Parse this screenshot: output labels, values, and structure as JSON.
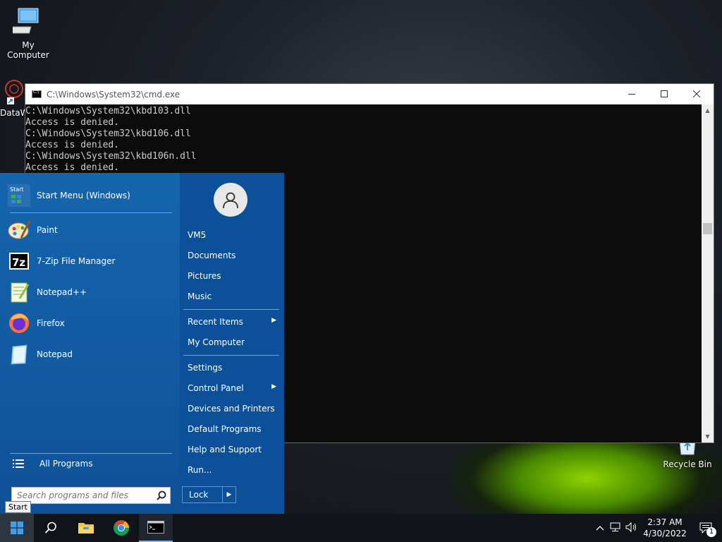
{
  "desktop": {
    "icons": [
      {
        "label": "My Computer"
      },
      {
        "label": "DataW"
      },
      {
        "label": "Recycle Bin"
      }
    ]
  },
  "cmd": {
    "title": "C:\\Windows\\System32\\cmd.exe",
    "lines": [
      "C:\\Windows\\System32\\kbd103.dll",
      "Access is denied.",
      "C:\\Windows\\System32\\kbd106.dll",
      "Access is denied.",
      "C:\\Windows\\System32\\kbd106n.dll",
      "Access is denied."
    ]
  },
  "start_menu": {
    "pinned": [
      {
        "label": "Start Menu (Windows)",
        "icon": "start-menu-icon"
      },
      {
        "label": "Paint",
        "icon": "paint-icon"
      },
      {
        "label": "7-Zip File Manager",
        "icon": "7zip-icon"
      },
      {
        "label": "Notepad++",
        "icon": "notepadpp-icon"
      },
      {
        "label": "Firefox",
        "icon": "firefox-icon"
      },
      {
        "label": "Notepad",
        "icon": "notepad-icon"
      }
    ],
    "all_programs": "All Programs",
    "search_placeholder": "Search programs and files",
    "right": [
      {
        "label": "VM5"
      },
      {
        "label": "Documents"
      },
      {
        "label": "Pictures"
      },
      {
        "label": "Music"
      },
      {
        "label": "Recent Items"
      },
      {
        "label": "My Computer"
      },
      {
        "label": "Settings"
      },
      {
        "label": "Control Panel"
      },
      {
        "label": "Devices and Printers"
      },
      {
        "label": "Default Programs"
      },
      {
        "label": "Help and Support"
      },
      {
        "label": "Run..."
      }
    ],
    "lock": "Lock",
    "tooltip": "Start"
  },
  "start_icon_text": "Start",
  "taskbar": {
    "time": "2:37 AM",
    "date": "4/30/2022",
    "notification_count": "1"
  },
  "colors": {
    "accent": "#1565ad",
    "taskbar": "#101318"
  }
}
